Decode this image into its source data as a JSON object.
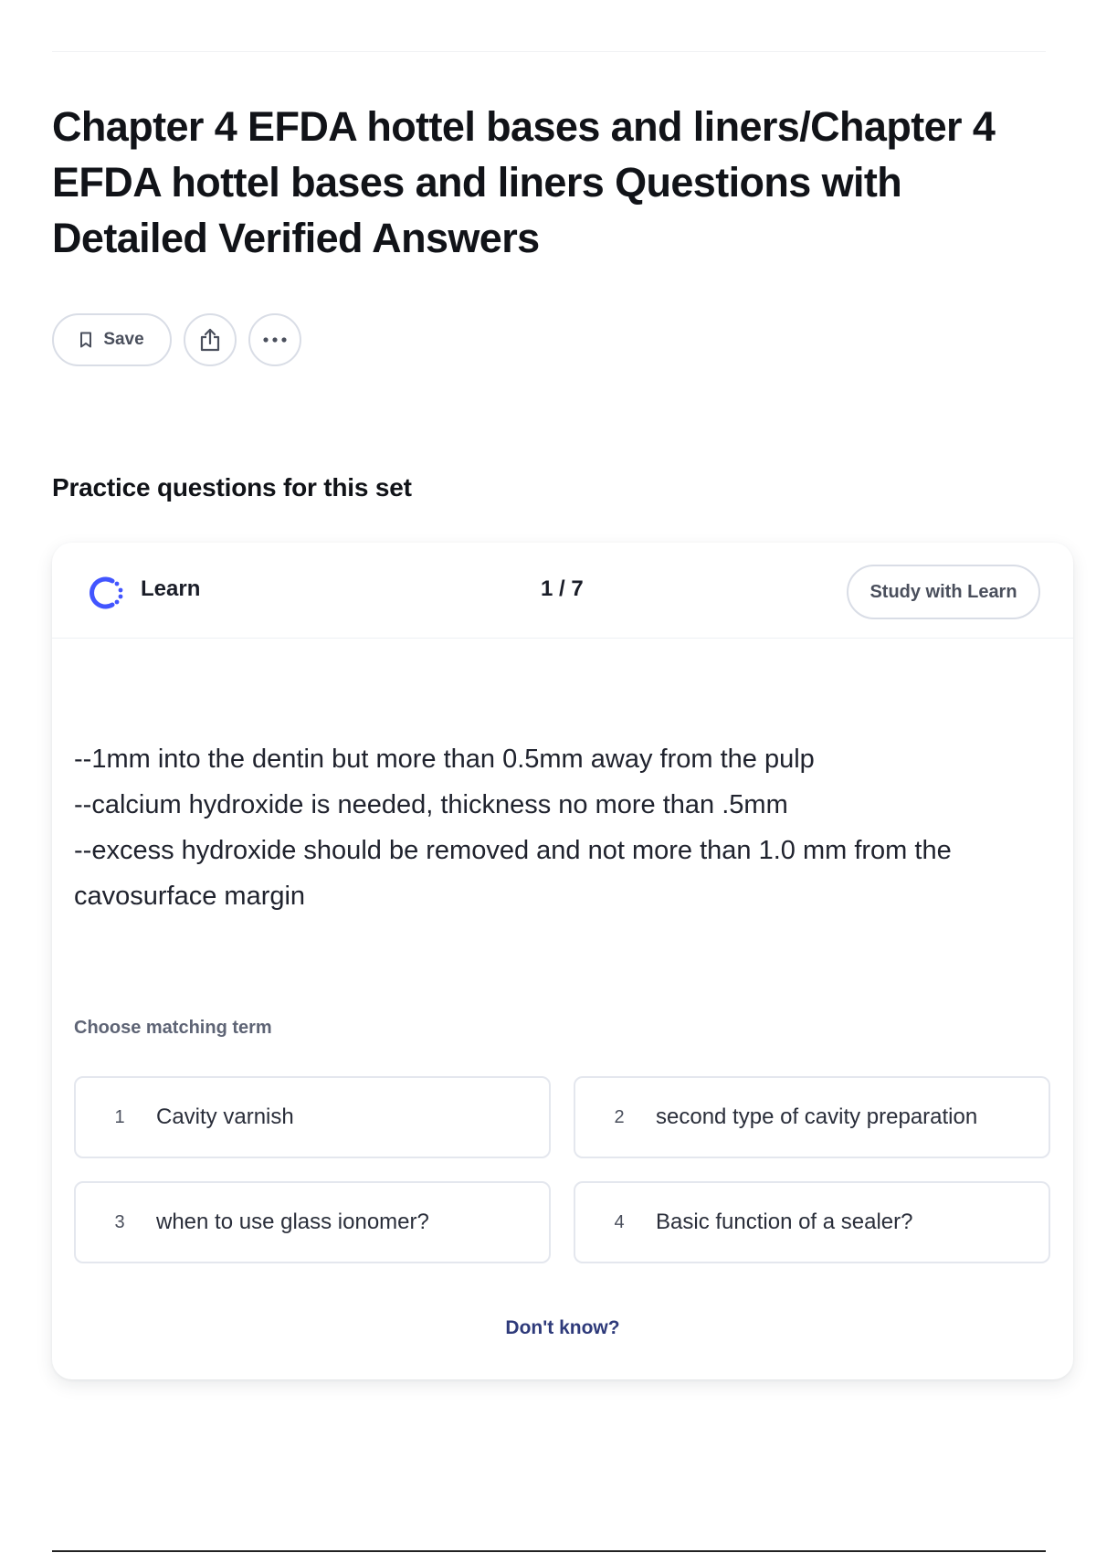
{
  "page": {
    "title": "Chapter 4 EFDA hottel bases and liners/Chapter 4 EFDA hottel bases and liners Questions with Detailed Verified Answers"
  },
  "actions": {
    "save_label": "Save",
    "save_icon": "bookmark-icon",
    "share_icon": "share-icon",
    "more_icon": "more-icon"
  },
  "practice": {
    "section_title": "Practice questions for this set",
    "mode_label": "Learn",
    "mode_icon": "learn-progress-icon",
    "progress": "1 / 7",
    "study_button": "Study with Learn",
    "prompt_lines": [
      "--1mm into the dentin but more than 0.5mm away from the pulp",
      "--calcium hydroxide is needed, thickness no more than .5mm",
      "--excess hydroxide should be removed and not more than 1.0 mm from the cavosurface margin"
    ],
    "choose_label": "Choose matching term",
    "options": [
      {
        "number": "1",
        "text": "Cavity varnish"
      },
      {
        "number": "2",
        "text": "second type of cavity preparation"
      },
      {
        "number": "3",
        "text": "when to use glass ionomer?"
      },
      {
        "number": "4",
        "text": "Basic function of a sealer?"
      }
    ],
    "dont_know": "Don't know?"
  },
  "colors": {
    "accent": "#4255ff",
    "link": "#2e3a7a",
    "border": "#d9dde6"
  }
}
